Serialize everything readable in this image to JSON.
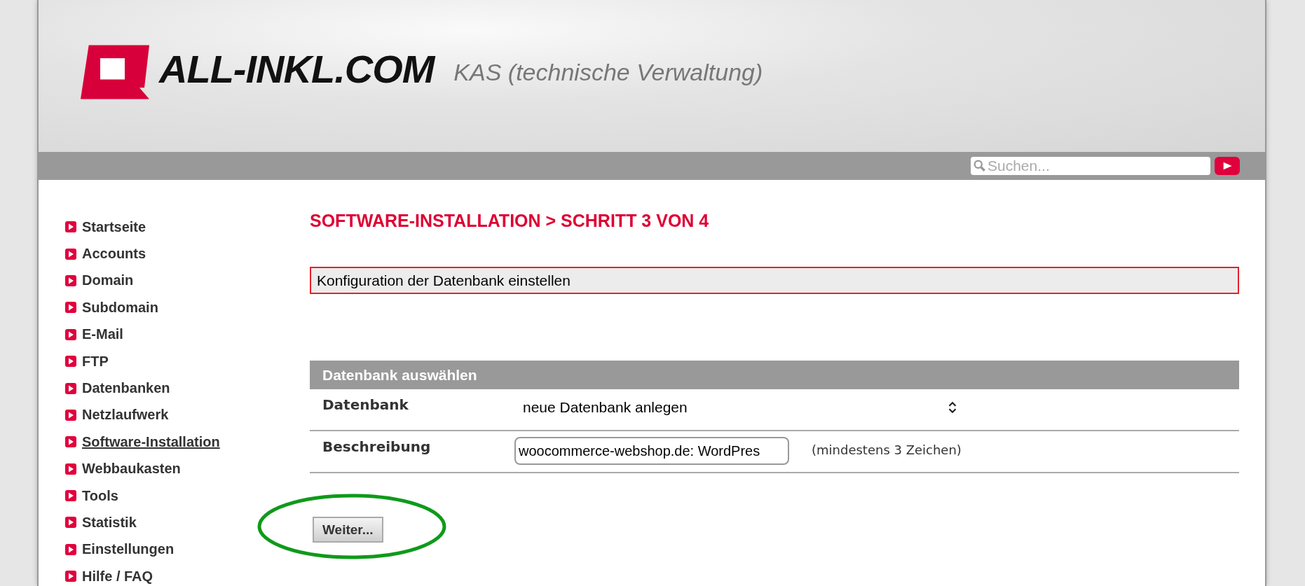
{
  "header": {
    "logo": "ALL-INKL.COM",
    "subtitle": "KAS (technische Verwaltung)"
  },
  "search": {
    "placeholder": "Suchen..."
  },
  "sidebar": {
    "items": [
      {
        "label": "Startseite",
        "selected": false
      },
      {
        "label": "Accounts",
        "selected": false
      },
      {
        "label": "Domain",
        "selected": false
      },
      {
        "label": "Subdomain",
        "selected": false
      },
      {
        "label": "E-Mail",
        "selected": false
      },
      {
        "label": "FTP",
        "selected": false
      },
      {
        "label": "Datenbanken",
        "selected": false
      },
      {
        "label": "Netzlaufwerk",
        "selected": false
      },
      {
        "label": "Software-Installation",
        "selected": true
      },
      {
        "label": "Webbaukasten",
        "selected": false
      },
      {
        "label": "Tools",
        "selected": false
      },
      {
        "label": "Statistik",
        "selected": false
      },
      {
        "label": "Einstellungen",
        "selected": false
      },
      {
        "label": "Hilfe / FAQ",
        "selected": false
      }
    ]
  },
  "page_title": "SOFTWARE-INSTALLATION > SCHRITT 3 VON 4",
  "notice": "Konfiguration der Datenbank einstellen",
  "section": {
    "title": "Datenbank auswählen",
    "rows": [
      {
        "kind": "select",
        "label": "Datenbank",
        "value": "neue Datenbank anlegen"
      },
      {
        "kind": "input",
        "label": "Beschreibung",
        "value": "woocommerce-webshop.de: WordPres",
        "hint": "(mindestens 3 Zeichen)"
      }
    ]
  },
  "button": "Weiter...",
  "annotation": {
    "kind": "ellipse"
  }
}
